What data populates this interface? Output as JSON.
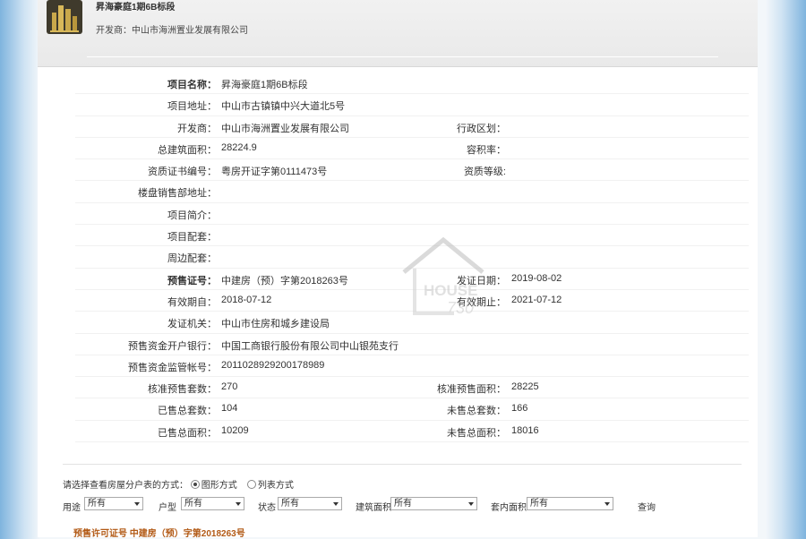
{
  "header": {
    "title": "昇海豪庭1期6B标段",
    "developer_line": "开发商：中山市海洲置业发展有限公司"
  },
  "details": {
    "project_name": {
      "label": "项目名称：",
      "value": "昇海豪庭1期6B标段"
    },
    "address": {
      "label": "项目地址：",
      "value": "中山市古镇镇中兴大道北5号"
    },
    "developer": {
      "label": "开发商：",
      "value": "中山市海洲置业发展有限公司"
    },
    "district": {
      "label": "行政区划：",
      "value": ""
    },
    "total_area": {
      "label": "总建筑面积：",
      "value": "28224.9"
    },
    "plot_ratio": {
      "label": "容积率：",
      "value": ""
    },
    "cert_no": {
      "label": "资质证书编号：",
      "value": "粤房开证字第0111473号"
    },
    "cert_level": {
      "label": "资质等级:",
      "value": ""
    },
    "sales_office": {
      "label": "楼盘销售部地址：",
      "value": ""
    },
    "intro": {
      "label": "项目简介：",
      "value": ""
    },
    "facilities": {
      "label": "项目配套：",
      "value": ""
    },
    "surroundings": {
      "label": "周边配套：",
      "value": ""
    },
    "presale_no": {
      "label": "预售证号：",
      "value": "中建房（预）字第2018263号"
    },
    "issue_date": {
      "label": "发证日期：",
      "value": "2019-08-02"
    },
    "valid_from": {
      "label": "有效期自：",
      "value": "2018-07-12"
    },
    "valid_to": {
      "label": "有效期止：",
      "value": "2021-07-12"
    },
    "issuer": {
      "label": "发证机关：",
      "value": "中山市住房和城乡建设局"
    },
    "bank": {
      "label": "预售资金开户银行：",
      "value": "中国工商银行股份有限公司中山银苑支行"
    },
    "account": {
      "label": "预售资金监管帐号：",
      "value": "2011028929200178989"
    },
    "approved_units": {
      "label": "核准预售套数：",
      "value": "270"
    },
    "approved_area": {
      "label": "核准预售面积：",
      "value": "28225"
    },
    "sold_units": {
      "label": "已售总套数：",
      "value": "104"
    },
    "unsold_units": {
      "label": "未售总套数：",
      "value": "166"
    },
    "sold_area": {
      "label": "已售总面积：",
      "value": "10209"
    },
    "unsold_area": {
      "label": "未售总面积：",
      "value": "18016"
    }
  },
  "watermark": {
    "text1": "HOUSE",
    "text2": "730"
  },
  "view_mode": {
    "prompt": "请选择查看房屋分户表的方式：",
    "graphic": "图形方式",
    "list": "列表方式"
  },
  "filters": {
    "use_label": "用途",
    "use_value": "所有",
    "type_label": "户型",
    "type_value": "所有",
    "status_label": "状态",
    "status_value": "所有",
    "area_label": "建筑面积",
    "area_value": "所有",
    "inner_label": "套内面积",
    "inner_value": "所有",
    "query_label": "查询"
  },
  "permit_heading": "预售许可证号 中建房（预）字第2018263号"
}
